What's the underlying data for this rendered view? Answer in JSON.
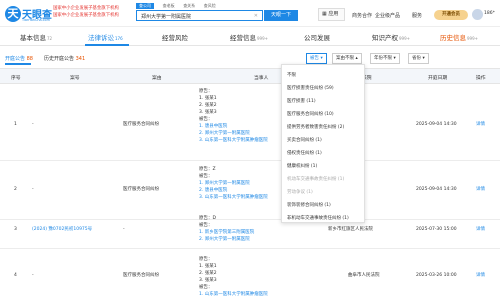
{
  "header": {
    "brand": "天眼查",
    "brand_sub": "TianYanCha.com",
    "logo_letter": "天",
    "promo_line1": "国家中小企业发展子基金旗下机构",
    "promo_line2": "国家中小企业发展子基金旗下机构",
    "search_tabs": [
      "查公司",
      "查老板",
      "查关系",
      "查风险"
    ],
    "search_value": "郑州大学第一附属医院",
    "search_button": "天眼一下",
    "apps": "应用",
    "nav": [
      "商务合作",
      "企业级产品",
      "服务"
    ],
    "vip": "开通会员",
    "phone": "186*"
  },
  "main_tabs": [
    {
      "label": "基本信息",
      "count": "72"
    },
    {
      "label": "法律诉讼",
      "count": "176"
    },
    {
      "label": "经营风险",
      "count": ""
    },
    {
      "label": "经营信息",
      "count": "999+"
    },
    {
      "label": "公司发展",
      "count": ""
    },
    {
      "label": "知识产权",
      "count": "999+"
    },
    {
      "label": "历史信息",
      "count": "999+"
    }
  ],
  "sub_tabs": [
    {
      "label": "开庭公告",
      "count": "88"
    },
    {
      "label": "历史开庭公告",
      "count": "341"
    }
  ],
  "filters": [
    "被告",
    "案由不限",
    "年份不限",
    "省份"
  ],
  "table": {
    "headers": [
      "序号",
      "案号",
      "案由",
      "当事人",
      "法院",
      "开庭日期",
      "操作"
    ],
    "rows": [
      {
        "index": "1",
        "case_no": "-",
        "cause": "医疗服务合同纠纷",
        "party_lines": [
          "原告：",
          "1. 张某1",
          "2. 张某2",
          "3. 张某3",
          "被告："
        ],
        "party_links": [
          "1. 唐县中医院",
          "2. 郑州大学第一附属医院",
          "3. 山东第一医科大学附属肿瘤医院"
        ],
        "court": "",
        "date": "2025-09-04 14:30",
        "action": "详情"
      },
      {
        "index": "2",
        "case_no": "-",
        "cause": "医疗服务合同纠纷",
        "party_lines": [
          "原告：Z",
          "被告："
        ],
        "party_links": [
          "1. 郑州大学第一附属医院",
          "2. 唐县中医院",
          "3. 山东第一医科大学附属肿瘤医院"
        ],
        "court": "",
        "date": "2025-09-04 14:30",
        "action": "详情"
      },
      {
        "index": "3",
        "case_no": "(2024) 豫0702民初10975号",
        "cause": "-",
        "party_lines": [
          "原告：D",
          "被告："
        ],
        "party_links": [
          "1. 新乡医学院第三附属医院",
          "2. 郑州大学第一附属医院"
        ],
        "court": "新乡市红旗区人民法院",
        "date": "2025-07-30 15:00",
        "action": "详情"
      },
      {
        "index": "4",
        "case_no": "-",
        "cause": "医疗服务合同纠纷",
        "party_lines": [
          "原告：",
          "1. 张某1",
          "2. 张某2",
          "3. 张某3",
          "被告："
        ],
        "party_links": [
          "1. 山东第一医科大学附属肿瘤医院"
        ],
        "court": "曲阜市人民法院",
        "date": "2025-03-26 10:00",
        "action": "详情"
      }
    ]
  },
  "dropdown": {
    "items": [
      {
        "label": "不限",
        "disabled": false
      },
      {
        "label": "医疗损害责任纠纷 (59)",
        "disabled": false
      },
      {
        "label": "医疗损害 (11)",
        "disabled": false
      },
      {
        "label": "医疗服务合同纠纷 (10)",
        "disabled": false
      },
      {
        "label": "提供劳务者致害责任纠纷 (2)",
        "disabled": false
      },
      {
        "label": "买卖合同纠纷 (1)",
        "disabled": false
      },
      {
        "label": "侵权责任纠纷 (1)",
        "disabled": false
      },
      {
        "label": "健康权纠纷 (1)",
        "disabled": false
      },
      {
        "label": "机动车交通事故责任纠纷 (1)",
        "disabled": true
      },
      {
        "label": "劳动争议 (1)",
        "disabled": true
      },
      {
        "label": "装饰装修合同纠纷 (1)",
        "disabled": false
      },
      {
        "label": "非机动车交通事故责任纠纷 (1)",
        "disabled": false
      }
    ]
  },
  "colors": {
    "accent": "#1e88e5",
    "orange": "#e65100",
    "vip": "#f6d28f"
  }
}
